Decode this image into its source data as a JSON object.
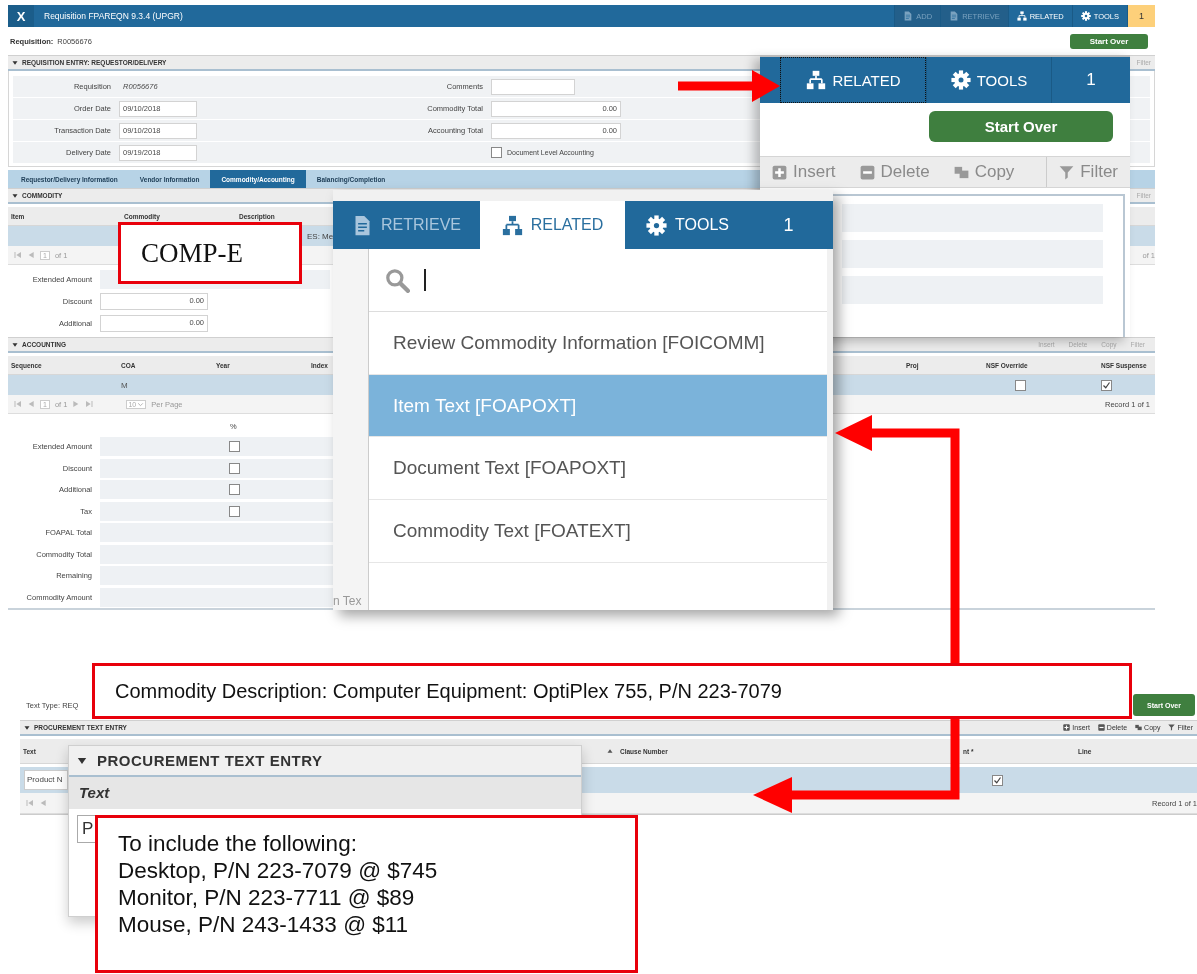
{
  "window": {
    "close": "X",
    "title": "Requisition FPAREQN 9.3.4 (UPGR)",
    "actions": [
      {
        "kind": "document",
        "label": "ADD",
        "disabled": true
      },
      {
        "kind": "document",
        "label": "RETRIEVE",
        "disabled": true
      },
      {
        "kind": "hierarchy",
        "label": "RELATED",
        "disabled": false
      },
      {
        "kind": "gear",
        "label": "TOOLS",
        "disabled": false
      },
      {
        "kind": "notification",
        "label": "1"
      }
    ]
  },
  "key_block": {
    "label": "Requisition:",
    "value": "R0056676",
    "start_over": "Start Over"
  },
  "entry": {
    "title": "REQUISITION ENTRY: REQUESTOR/DELIVERY",
    "filter": "Filter",
    "left_fields": [
      {
        "label": "Requisition",
        "value": "R0056676",
        "disabled": true
      },
      {
        "label": "Order Date",
        "value": "09/10/2018",
        "disabled": false
      },
      {
        "label": "Transaction Date",
        "value": "09/10/2018",
        "disabled": false
      },
      {
        "label": "Delivery Date",
        "value": "09/19/2018",
        "disabled": false
      }
    ],
    "right_fields": [
      {
        "kind": "text",
        "label": "Comments"
      },
      {
        "kind": "amount",
        "label": "Commodity Total",
        "value": "0.00"
      },
      {
        "kind": "amount",
        "label": "Accounting Total",
        "value": "0.00"
      },
      {
        "kind": "checkbox",
        "label": "Document Level Accounting",
        "checked": false
      }
    ]
  },
  "tabs": [
    {
      "label": "Requestor/Delivery Information",
      "selected": false
    },
    {
      "label": "Vendor Information",
      "selected": false
    },
    {
      "label": "Commodity/Accounting",
      "selected": true
    },
    {
      "label": "Balancing/Completion",
      "selected": false
    }
  ],
  "commodity": {
    "title": "COMMODITY",
    "filter": "Filter",
    "columns": [
      "Item",
      "Commodity",
      "Description"
    ],
    "row_fragment": "ES: Me",
    "pager": {
      "page": "1",
      "total": "of 1",
      "record": "of 1"
    },
    "fields": [
      {
        "label": "Extended Amount"
      },
      {
        "label": "Discount",
        "value": "0.00"
      },
      {
        "label": "Additional",
        "value": "0.00"
      }
    ]
  },
  "accounting": {
    "title": "ACCOUNTING",
    "toolbar": [
      "Insert",
      "Delete",
      "Copy",
      "Filter"
    ],
    "columns": [
      "Sequence",
      "COA",
      "Year",
      "Index",
      "Proj",
      "NSF Override",
      "NSF Suspense"
    ],
    "row": {
      "coa": "M",
      "nsf_override": false,
      "nsf_suspense": true
    },
    "pager": {
      "page": "1",
      "total": "of 1",
      "per_page": "10",
      "per_page_label": "Per Page",
      "record": "Record 1 of 1"
    },
    "percent_label": "%",
    "totals": [
      {
        "label": "Extended Amount",
        "kind": "checkbox",
        "checked": false
      },
      {
        "label": "Discount",
        "kind": "checkbox",
        "checked": false
      },
      {
        "label": "Additional",
        "kind": "checkbox",
        "checked": false
      },
      {
        "label": "Tax",
        "kind": "checkbox",
        "checked": false
      },
      {
        "label": "FOAPAL Total",
        "kind": "plain"
      },
      {
        "label": "Commodity Total",
        "kind": "plain"
      },
      {
        "label": "Remaining",
        "kind": "plain"
      },
      {
        "label": "Commodity Amount",
        "kind": "plain"
      }
    ]
  },
  "related_zoom": {
    "tabs": [
      {
        "kind": "hierarchy",
        "label": "RELATED",
        "focused": true
      },
      {
        "kind": "gear",
        "label": "TOOLS",
        "focused": false
      },
      {
        "kind": "notification",
        "label": "1",
        "focused": false
      }
    ],
    "start_over": "Start Over",
    "toolbar": [
      {
        "kind": "insert",
        "label": "Insert"
      },
      {
        "kind": "delete",
        "label": "Delete"
      },
      {
        "kind": "copy",
        "label": "Copy"
      },
      {
        "kind": "filter",
        "label": "Filter"
      }
    ]
  },
  "comp_callout": {
    "text": "COMP-E"
  },
  "related_menu": {
    "tabs": [
      {
        "kind": "document",
        "label": "RETRIEVE",
        "selected": false
      },
      {
        "kind": "hierarchy",
        "label": "RELATED",
        "selected": true
      },
      {
        "kind": "gear",
        "label": "TOOLS",
        "selected": false
      },
      {
        "kind": "notification",
        "label": "1",
        "selected": false
      }
    ],
    "items": [
      {
        "label": "Review Commodity Information [FOICOMM]",
        "selected": false
      },
      {
        "label": "Item Text [FOAPOXT]",
        "selected": true
      },
      {
        "label": "Document Text [FOAPOXT]",
        "selected": false
      },
      {
        "label": "Commodity Text [FOATEXT]",
        "selected": false
      }
    ],
    "background_fragment": "n Tex"
  },
  "bottom_screen": {
    "text_type": "Text Type: REQ",
    "start_over": "Start Over",
    "title": "PROCUREMENT TEXT ENTRY",
    "toolbar": [
      {
        "kind": "insert",
        "label": "Insert"
      },
      {
        "kind": "delete",
        "label": "Delete"
      },
      {
        "kind": "copy",
        "label": "Copy"
      },
      {
        "kind": "filter",
        "label": "Filter"
      }
    ],
    "columns": [
      "Text",
      "Clause Number",
      "nt *",
      "Line"
    ],
    "row": {
      "text": "Product N",
      "checked": true
    },
    "record": "Record 1 of 1"
  },
  "commodity_callout": {
    "text": "Commodity Description: Computer Equipment: OptiPlex 755, P/N 223-7079"
  },
  "text_entry_zoom": {
    "title": "PROCUREMENT TEXT ENTRY",
    "field_label": "Text",
    "value": "P"
  },
  "include_callout": {
    "lines": [
      "To include the following:",
      "Desktop, P/N 223-7079 @ $745",
      "Monitor, P/N 223-7711 @ $89",
      "Mouse, P/N 243-1433 @ $11"
    ]
  }
}
